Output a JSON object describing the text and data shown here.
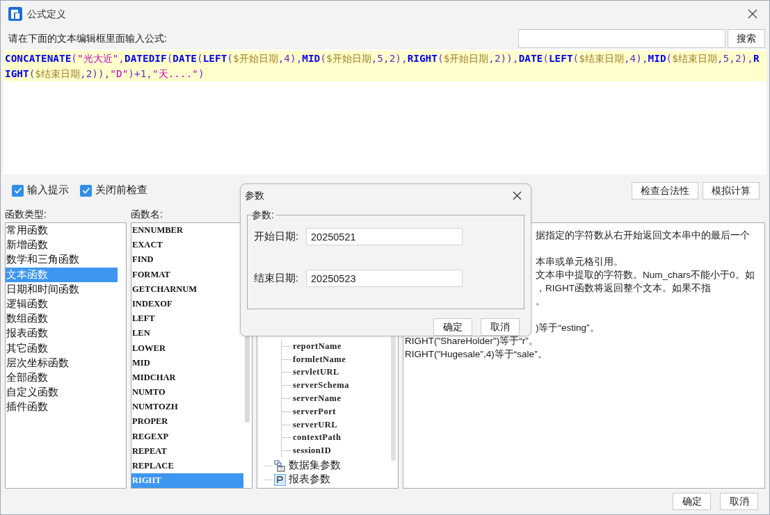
{
  "window": {
    "title": "公式定义"
  },
  "editor": {
    "label": "请在下面的文本编辑框里面输入公式:",
    "search_button": "搜索",
    "formula": [
      {
        "kind": "func",
        "text": "CONCATENATE"
      },
      {
        "kind": "plain",
        "text": "("
      },
      {
        "kind": "string",
        "text": "\"光大近\""
      },
      {
        "kind": "plain",
        "text": ","
      },
      {
        "kind": "func",
        "text": "DATEDIF"
      },
      {
        "kind": "plain",
        "text": "("
      },
      {
        "kind": "func",
        "text": "DATE"
      },
      {
        "kind": "plain",
        "text": "("
      },
      {
        "kind": "func",
        "text": "LEFT"
      },
      {
        "kind": "plain",
        "text": "("
      },
      {
        "kind": "param",
        "text": "$开始日期"
      },
      {
        "kind": "plain",
        "text": ",4),"
      },
      {
        "kind": "func",
        "text": "MID"
      },
      {
        "kind": "plain",
        "text": "("
      },
      {
        "kind": "param",
        "text": "$开始日期"
      },
      {
        "kind": "plain",
        "text": ",5,2),"
      },
      {
        "kind": "func",
        "text": "RIGHT"
      },
      {
        "kind": "plain",
        "text": "("
      },
      {
        "kind": "param",
        "text": "$开始日期"
      },
      {
        "kind": "plain",
        "text": ",2)),"
      },
      {
        "kind": "func",
        "text": "DATE"
      },
      {
        "kind": "plain",
        "text": "("
      },
      {
        "kind": "func",
        "text": "LEFT"
      },
      {
        "kind": "plain",
        "text": "("
      },
      {
        "kind": "param",
        "text": "$结束日期"
      },
      {
        "kind": "plain",
        "text": ",4),"
      },
      {
        "kind": "func",
        "text": "MID"
      },
      {
        "kind": "plain",
        "text": "("
      },
      {
        "kind": "param",
        "text": "$结束日期"
      },
      {
        "kind": "plain",
        "text": ",5,2),"
      },
      {
        "kind": "func",
        "text": "RIGHT"
      },
      {
        "kind": "plain",
        "text": "("
      },
      {
        "kind": "param",
        "text": "$结束日期"
      },
      {
        "kind": "plain",
        "text": ",2)),"
      },
      {
        "kind": "string",
        "text": "\"D\""
      },
      {
        "kind": "plain",
        "text": ")+1,"
      },
      {
        "kind": "string",
        "text": "\"天....\""
      },
      {
        "kind": "plain",
        "text": ")"
      }
    ]
  },
  "options": [
    {
      "label": "输入提示",
      "checked": true
    },
    {
      "label": "关闭前检查",
      "checked": true
    }
  ],
  "action_buttons": [
    "检查合法性",
    "模拟计算"
  ],
  "function_types": {
    "label": "函数类型:",
    "items": [
      {
        "label": "常用函数",
        "selected": false
      },
      {
        "label": "新增函数",
        "selected": false
      },
      {
        "label": "数学和三角函数",
        "selected": false
      },
      {
        "label": "文本函数",
        "selected": true
      },
      {
        "label": "日期和时间函数",
        "selected": false
      },
      {
        "label": "逻辑函数",
        "selected": false
      },
      {
        "label": "数组函数",
        "selected": false
      },
      {
        "label": "报表函数",
        "selected": false
      },
      {
        "label": "其它函数",
        "selected": false
      },
      {
        "label": "层次坐标函数",
        "selected": false
      },
      {
        "label": "全部函数",
        "selected": false
      },
      {
        "label": "自定义函数",
        "selected": false
      },
      {
        "label": "插件函数",
        "selected": false
      }
    ]
  },
  "function_names": {
    "label": "函数名:",
    "items": [
      {
        "label": "ENNUMBER",
        "selected": false
      },
      {
        "label": "EXACT",
        "selected": false
      },
      {
        "label": "FIND",
        "selected": false
      },
      {
        "label": "FORMAT",
        "selected": false
      },
      {
        "label": "GETCHARNUM",
        "selected": false
      },
      {
        "label": "INDEXOF",
        "selected": false
      },
      {
        "label": "LEFT",
        "selected": false
      },
      {
        "label": "LEN",
        "selected": false
      },
      {
        "label": "LOWER",
        "selected": false
      },
      {
        "label": "MID",
        "selected": false
      },
      {
        "label": "MIDCHAR",
        "selected": false
      },
      {
        "label": "NUMTO",
        "selected": false
      },
      {
        "label": "NUMTOZH",
        "selected": false
      },
      {
        "label": "PROPER",
        "selected": false
      },
      {
        "label": "REGEXP",
        "selected": false
      },
      {
        "label": "REPEAT",
        "selected": false
      },
      {
        "label": "REPLACE",
        "selected": false
      },
      {
        "label": "RIGHT",
        "selected": true
      }
    ]
  },
  "tree": {
    "items": [
      {
        "children": [
          {
            "label": "reportName"
          },
          {
            "label": "formletName"
          },
          {
            "label": "servletURL"
          },
          {
            "label": "serverSchema"
          },
          {
            "label": "serverName"
          },
          {
            "label": "serverPort"
          },
          {
            "label": "serverURL"
          },
          {
            "label": "contextPath"
          },
          {
            "label": "sessionID"
          }
        ]
      },
      {
        "label": "数据集参数",
        "kind": "dataset"
      },
      {
        "label": "报表参数",
        "kind": "report"
      }
    ]
  },
  "description": {
    "paragraphs": [
      {
        "lines": [
          {
            "kind": "covered",
            "text": "据指定的字符数从右开始返回文本串中的最后一个"
          }
        ]
      },
      {
        "lines": [
          {
            "kind": "covered",
            "text": "本串或单元格引用。"
          },
          {
            "kind": "covered",
            "text": "文本串中提取的字符数。Num_chars不能小于0。如"
          },
          {
            "kind": "covered",
            "text": "，RIGHT函数将返回整个文本。如果不指"
          },
          {
            "kind": "covered",
            "text": "。"
          }
        ]
      },
      {
        "lines": [
          {
            "kind": "covered",
            "text": ")等于“esting”。"
          },
          {
            "kind": "full",
            "text": "RIGHT(\"ShareHolder\")等于“r”。"
          },
          {
            "kind": "full",
            "text": "RIGHT(\"Hugesale\",4)等于“sale”。"
          }
        ]
      }
    ]
  },
  "footer_buttons": [
    "确定",
    "取消"
  ],
  "dialog": {
    "title": "参数",
    "group": "参数:",
    "fields": [
      {
        "label": "开始日期:",
        "value": "20250521"
      },
      {
        "label": "结束日期:",
        "value": "20250523"
      }
    ],
    "buttons": [
      "确定",
      "取消"
    ]
  }
}
